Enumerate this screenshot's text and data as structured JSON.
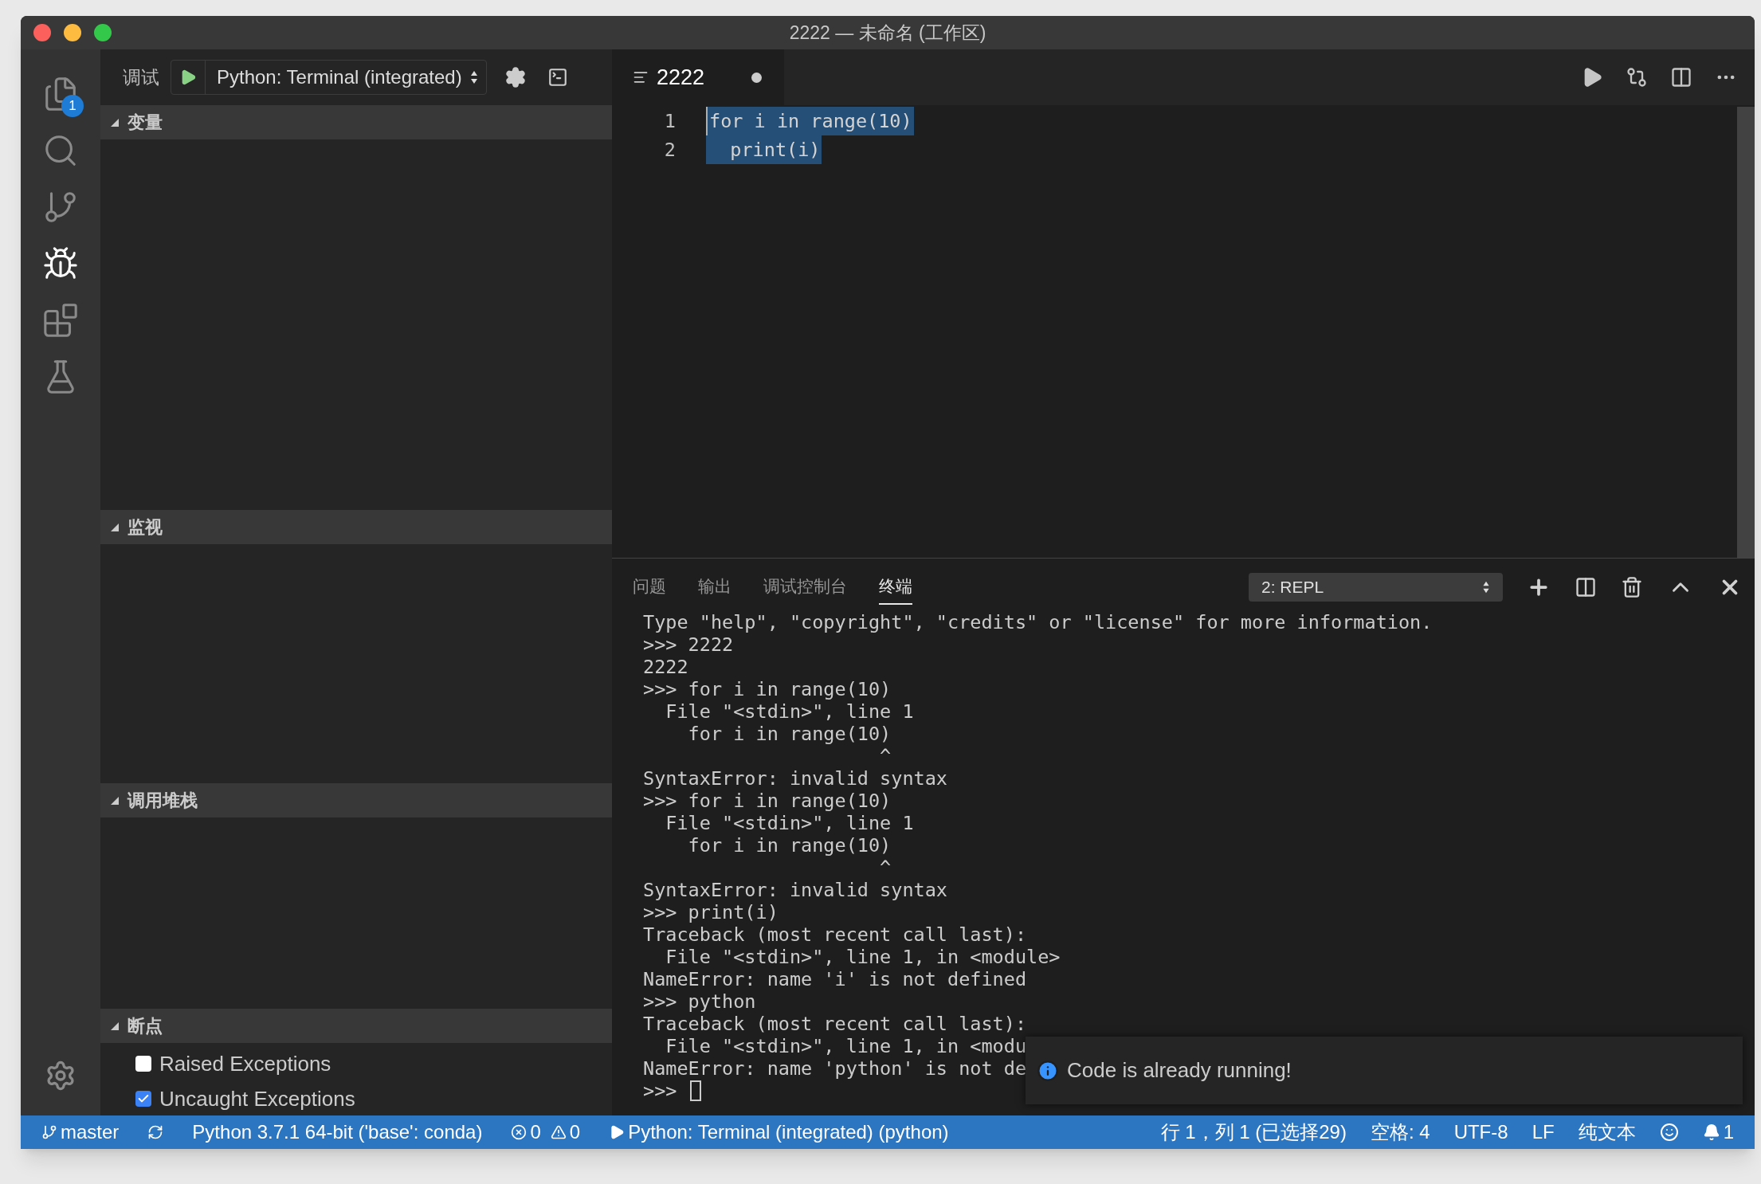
{
  "window": {
    "title": "2222 — 未命名 (工作区)"
  },
  "activity_bar": [
    {
      "selected": false,
      "badge": "1"
    },
    {
      "selected": false
    },
    {
      "selected": false
    },
    {
      "selected": true
    },
    {
      "selected": false
    },
    {
      "selected": false
    }
  ],
  "debug_toolbar": {
    "label": "调试",
    "configuration": "Python: Terminal (integrated)"
  },
  "sidebar": {
    "sections": [
      {
        "title": "变量",
        "expanded": true
      },
      {
        "title": "监视",
        "expanded": true
      },
      {
        "title": "调用堆栈",
        "expanded": true
      },
      {
        "title": "断点",
        "expanded": true,
        "items": [
          {
            "label": "Raised Exceptions",
            "checked": false
          },
          {
            "label": "Uncaught Exceptions",
            "checked": true
          }
        ]
      }
    ]
  },
  "editor": {
    "tab": {
      "title": "2222",
      "dirty": true
    },
    "lines": [
      {
        "number": "1",
        "text": "for i in range(10)",
        "selected": true
      },
      {
        "number": "2",
        "text": "  print(i)",
        "selected": true
      }
    ]
  },
  "panel": {
    "tabs": [
      {
        "label": "问题",
        "selected": false
      },
      {
        "label": "输出",
        "selected": false
      },
      {
        "label": "调试控制台",
        "selected": false
      },
      {
        "label": "终端",
        "selected": true
      }
    ],
    "terminal_select": "2: REPL",
    "terminal_lines": [
      "Type \"help\", \"copyright\", \"credits\" or \"license\" for more information.",
      ">>> 2222",
      "2222",
      ">>> for i in range(10)",
      "  File \"<stdin>\", line 1",
      "    for i in range(10)",
      "                     ^",
      "SyntaxError: invalid syntax",
      ">>> for i in range(10)",
      "  File \"<stdin>\", line 1",
      "    for i in range(10)",
      "                     ^",
      "SyntaxError: invalid syntax",
      ">>> print(i)",
      "Traceback (most recent call last):",
      "  File \"<stdin>\", line 1, in <module>",
      "NameError: name 'i' is not defined",
      ">>> python",
      "Traceback (most recent call last):",
      "  File \"<stdin>\", line 1, in <modu",
      "NameError: name 'python' is not de",
      ">>> "
    ]
  },
  "notification": {
    "message": "Code is already running!"
  },
  "status_bar": {
    "left": [
      {
        "kind": "branch",
        "text": "master"
      },
      {
        "kind": "sync"
      },
      {
        "kind": "text",
        "text": "Python 3.7.1 64-bit ('base': conda)"
      },
      {
        "kind": "problems",
        "errors": "0",
        "warnings": "0"
      },
      {
        "kind": "debug",
        "text": "Python: Terminal (integrated) (python)"
      }
    ],
    "right": [
      {
        "kind": "text",
        "text": "行 1，列 1 (已选择29)"
      },
      {
        "kind": "text",
        "text": "空格: 4"
      },
      {
        "kind": "text",
        "text": "UTF-8"
      },
      {
        "kind": "text",
        "text": "LF"
      },
      {
        "kind": "text",
        "text": "纯文本"
      },
      {
        "kind": "feedback"
      },
      {
        "kind": "bell",
        "text": "1"
      }
    ]
  }
}
